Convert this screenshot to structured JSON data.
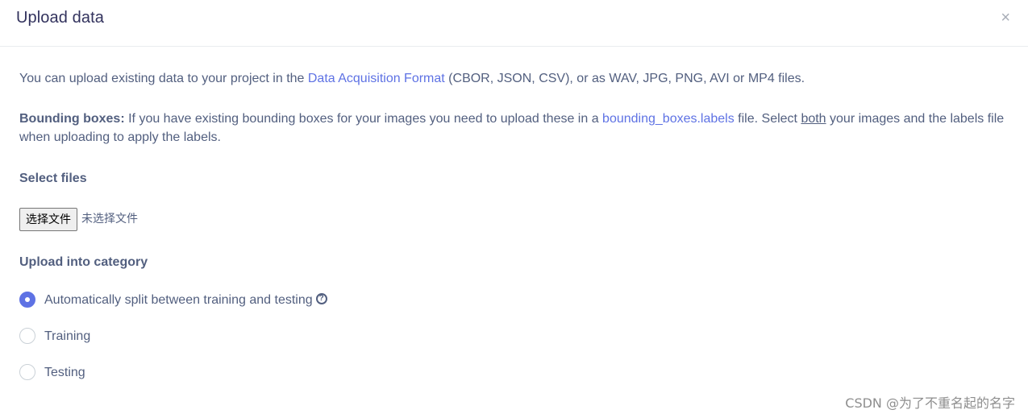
{
  "header": {
    "title": "Upload data",
    "close_symbol": "×"
  },
  "intro": {
    "text_before": "You can upload existing data to your project in the ",
    "link_text": "Data Acquisition Format",
    "text_after": " (CBOR, JSON, CSV), or as WAV, JPG, PNG, AVI or MP4 files."
  },
  "bounding": {
    "bold_label": "Bounding boxes:",
    "text_before": " If you have existing bounding boxes for your images you need to upload these in a ",
    "link_text": "bounding_boxes.labels",
    "text_mid": " file. Select ",
    "underline_text": "both",
    "text_after": " your images and the labels file when uploading to apply the labels."
  },
  "select_files": {
    "label": "Select files",
    "button_label": "选择文件",
    "status_text": "未选择文件"
  },
  "category": {
    "label": "Upload into category",
    "options": [
      {
        "label": "Automatically split between training and testing",
        "checked": true
      },
      {
        "label": "Training",
        "checked": false
      },
      {
        "label": "Testing",
        "checked": false
      }
    ],
    "help_symbol": "?"
  },
  "watermark": "CSDN @为了不重名起的名字",
  "colors": {
    "accent": "#5e72e4",
    "text": "#525f7f",
    "title": "#32325d"
  },
  "icons": {
    "close": "close-icon",
    "help": "question-circle-icon"
  }
}
